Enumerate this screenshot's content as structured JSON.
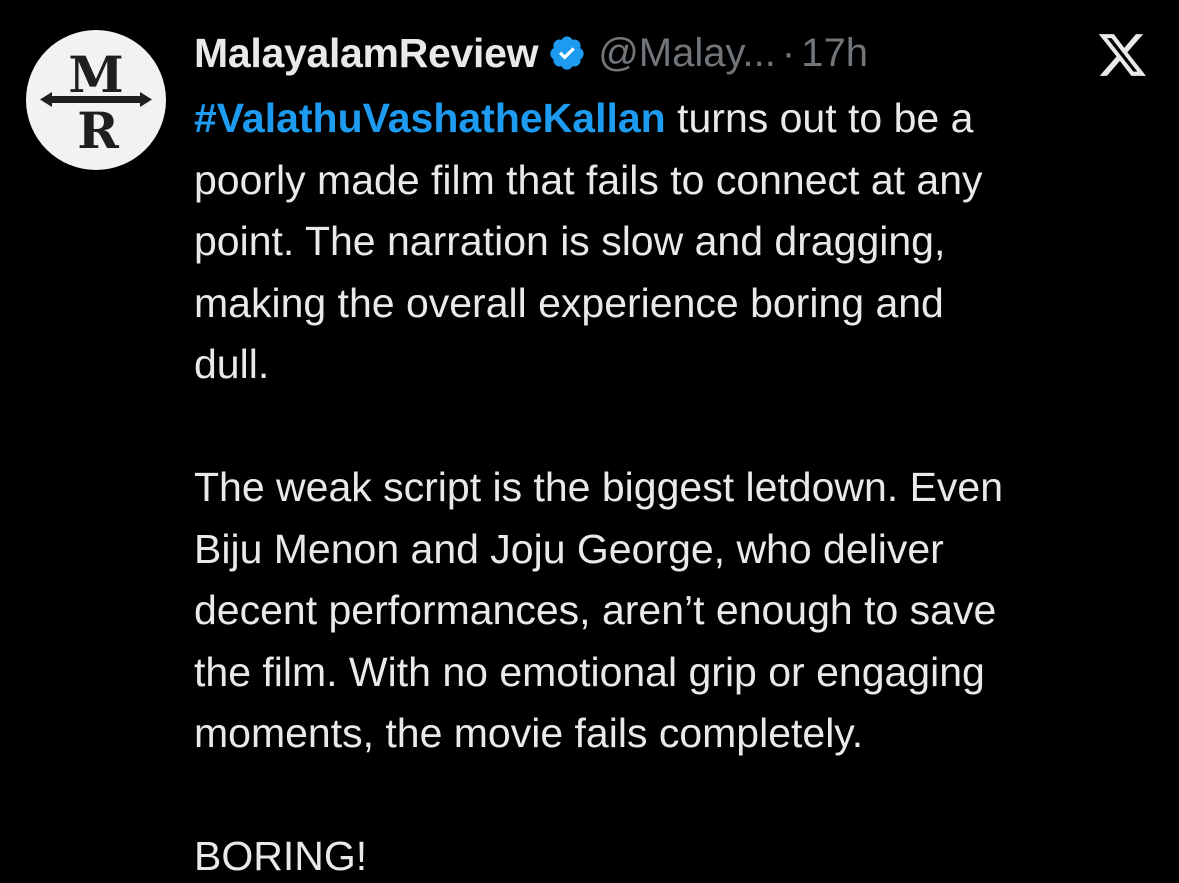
{
  "author": {
    "display_name": "MalayalamReview",
    "handle": "@Malay...",
    "separator": "·",
    "timestamp": "17h",
    "verified": true,
    "avatar_initials": "MR",
    "avatar_icon": "mr-monogram-avatar"
  },
  "brand": {
    "logo": "x-logo-icon"
  },
  "tweet": {
    "hashtag": "#ValathuVashatheKallan",
    "lines": [
      " turns out to be a",
      "poorly made film that fails to connect at any",
      "point. The narration is slow and dragging,",
      "making the overall experience boring and",
      "dull.",
      "The weak script is the biggest letdown. Even",
      "Biju Menon and Joju George, who deliver",
      "decent performances, aren’t enough to save",
      "the film. With no emotional grip or engaging",
      "moments, the movie fails completely.",
      "BORING!"
    ]
  },
  "colors": {
    "background": "#000000",
    "text": "#e7e9ea",
    "muted": "#71767b",
    "accent": "#1d9bf0"
  }
}
